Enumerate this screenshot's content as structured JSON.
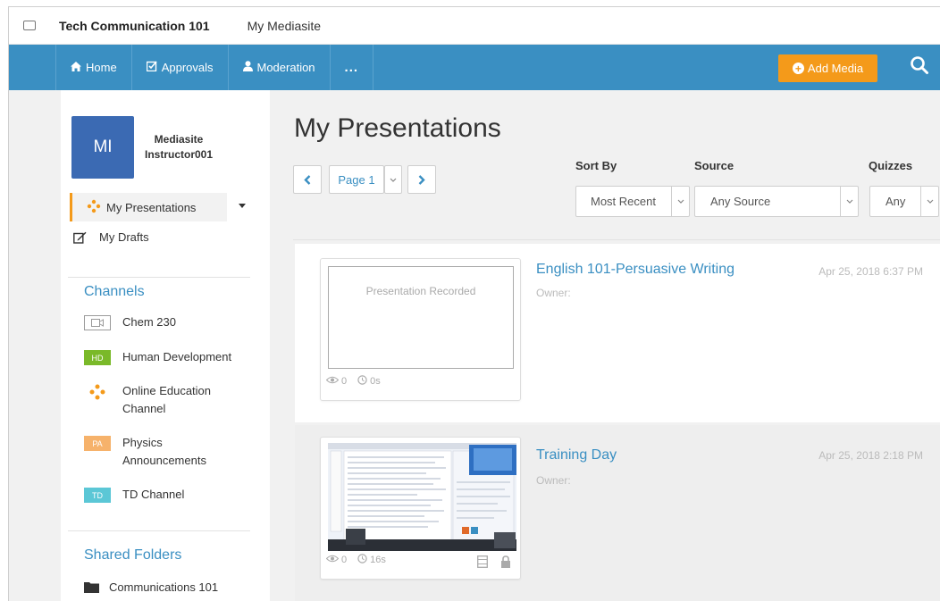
{
  "title_bar": {
    "course": "Tech Communication 101",
    "site": "My Mediasite"
  },
  "nav": {
    "items": [
      {
        "label": "Home",
        "icon": "home-icon"
      },
      {
        "label": "Approvals",
        "icon": "checkbox-edit-icon"
      },
      {
        "label": "Moderation",
        "icon": "user-icon"
      }
    ],
    "more_label": "...",
    "add_media_label": "Add Media",
    "search_icon": "search-icon"
  },
  "user": {
    "initials": "MI",
    "name": "Mediasite Instructor001"
  },
  "sidebar": {
    "my_presentations": "My Presentations",
    "my_drafts": "My Drafts",
    "channels_title": "Channels",
    "channels": [
      {
        "badge": "",
        "label": "Chem 230"
      },
      {
        "badge": "HD",
        "label": "Human Development"
      },
      {
        "badge": "",
        "label": "Online Education Channel"
      },
      {
        "badge": "PA",
        "label": "Physics Announcements"
      },
      {
        "badge": "TD",
        "label": "TD Channel"
      }
    ],
    "shared_folders_title": "Shared Folders",
    "folders": [
      {
        "label": "Communications 101"
      }
    ]
  },
  "main": {
    "title": "My Presentations",
    "pager": {
      "page_label": "Page 1"
    },
    "filters": {
      "sort_by_label": "Sort By",
      "sort_by_value": "Most Recent",
      "source_label": "Source",
      "source_value": "Any Source",
      "quizzes_label": "Quizzes",
      "quizzes_value": "Any"
    },
    "presentations": [
      {
        "title": "English 101-Persuasive Writing",
        "owner": "Owner:",
        "date": "Apr 25, 2018 6:37 PM",
        "thumbnail_text": "Presentation Recorded",
        "views": "0",
        "duration": "0s"
      },
      {
        "title": "Training Day",
        "owner": "Owner:",
        "date": "Apr 25, 2018 2:18 PM",
        "thumbnail_text": "",
        "views": "0",
        "duration": "16s"
      }
    ]
  },
  "colors": {
    "nav_blue": "#3a8fc2",
    "accent_orange": "#f49a1a",
    "avatar_blue": "#3b6ab3"
  }
}
